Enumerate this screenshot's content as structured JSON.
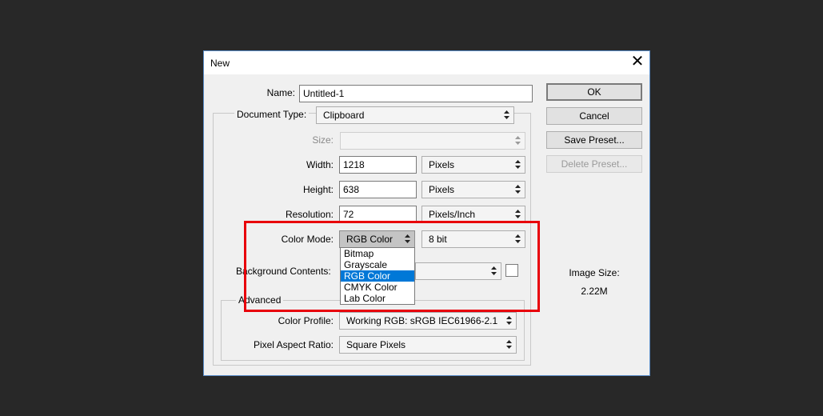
{
  "dialog": {
    "title": "New",
    "close_glyph": "✕"
  },
  "form": {
    "name_label": "Name:",
    "name_value": "Untitled-1",
    "document_type_label": "Document Type:",
    "document_type_value": "Clipboard",
    "size_label": "Size:",
    "size_value": "",
    "width_label": "Width:",
    "width_value": "1218",
    "width_unit": "Pixels",
    "height_label": "Height:",
    "height_value": "638",
    "height_unit": "Pixels",
    "resolution_label": "Resolution:",
    "resolution_value": "72",
    "resolution_unit": "Pixels/Inch",
    "color_mode_label": "Color Mode:",
    "color_mode_value": "RGB Color",
    "bit_depth_value": "8 bit",
    "background_label": "Background Contents:",
    "background_value": ""
  },
  "color_mode_options": [
    "Bitmap",
    "Grayscale",
    "RGB Color",
    "CMYK Color",
    "Lab Color"
  ],
  "color_mode_selected_index": 2,
  "advanced": {
    "legend": "Advanced",
    "color_profile_label": "Color Profile:",
    "color_profile_value": "Working RGB:  sRGB IEC61966-2.1",
    "pixel_aspect_label": "Pixel Aspect Ratio:",
    "pixel_aspect_value": "Square Pixels"
  },
  "buttons": {
    "ok": "OK",
    "cancel": "Cancel",
    "save_preset": "Save Preset...",
    "delete_preset": "Delete Preset..."
  },
  "image_size": {
    "label": "Image Size:",
    "value": "2.22M"
  },
  "colors": {
    "highlight": "#e8000a",
    "selection": "#0078d7",
    "dialog_border": "#5a8dc8",
    "background": "#282828"
  }
}
